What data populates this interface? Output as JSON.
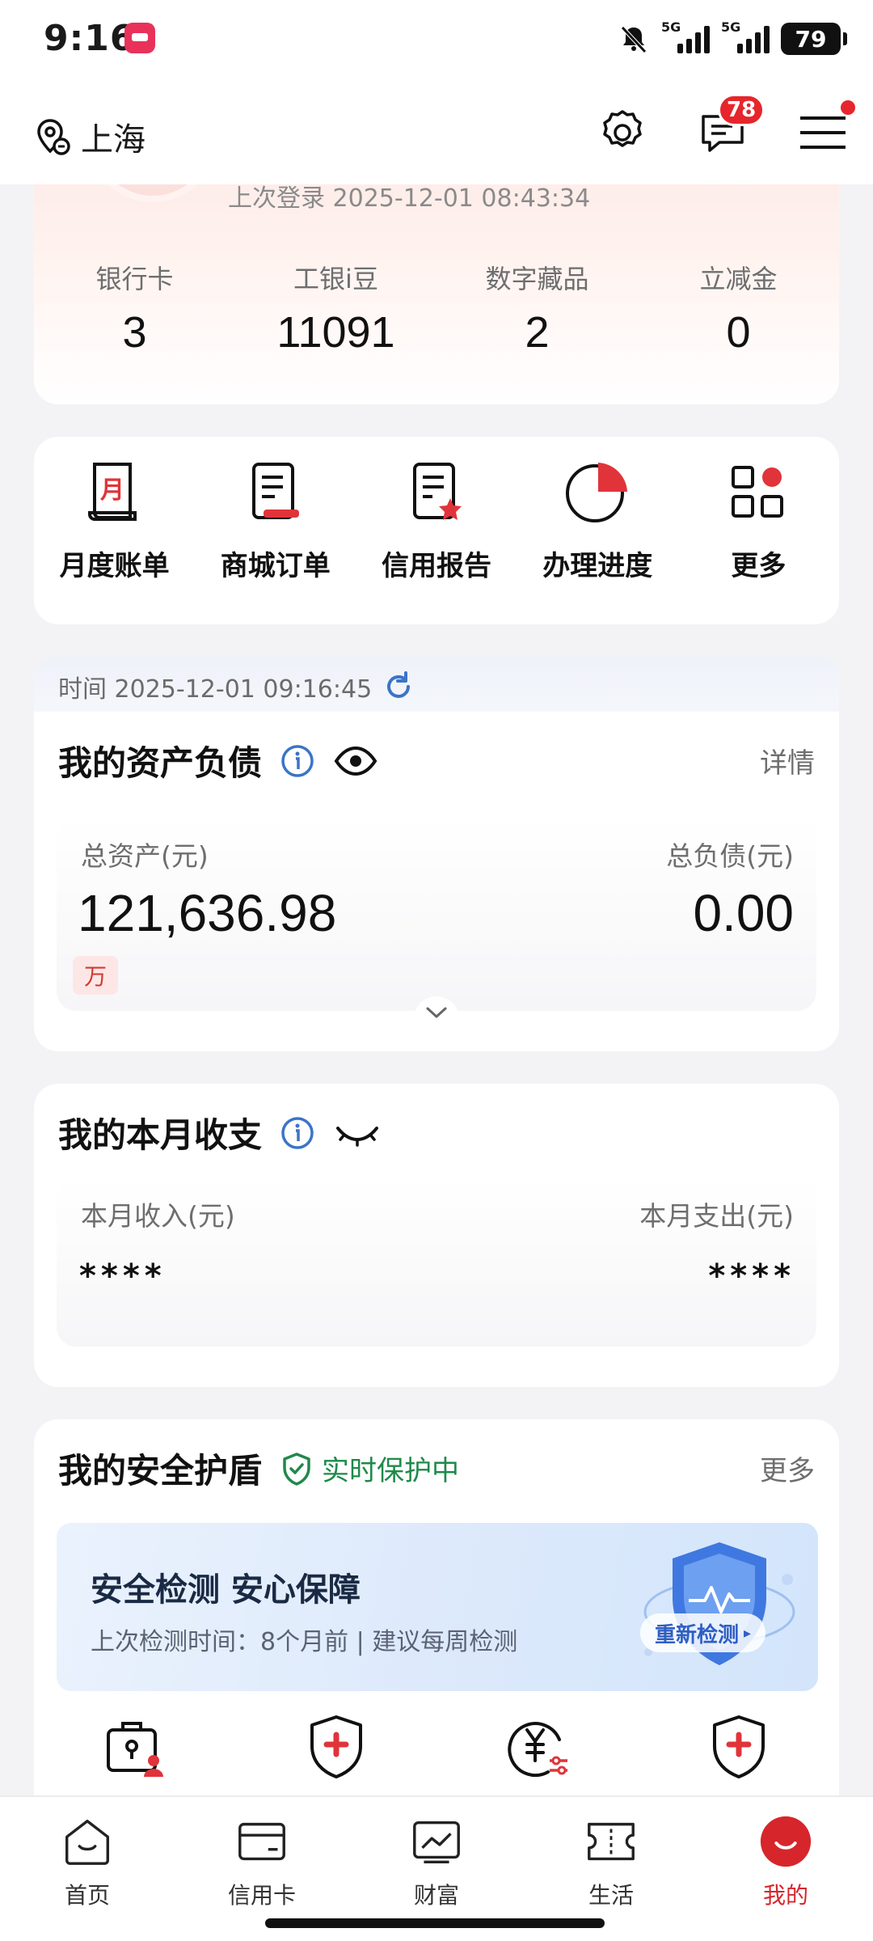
{
  "status_bar": {
    "time": "9:16",
    "battery": "79",
    "network_1": "5G",
    "network_2": "5G"
  },
  "header": {
    "location": "上海",
    "message_badge": "78"
  },
  "profile": {
    "last_login": "上次登录 2025-12-01 08:43:34",
    "stats": [
      {
        "label": "银行卡",
        "value": "3"
      },
      {
        "label": "工银i豆",
        "value": "11091"
      },
      {
        "label": "数字藏品",
        "value": "2"
      },
      {
        "label": "立减金",
        "value": "0"
      }
    ]
  },
  "quick_actions": [
    {
      "label": "月度账单",
      "icon": "monthly-bill-icon"
    },
    {
      "label": "商城订单",
      "icon": "mall-order-icon"
    },
    {
      "label": "信用报告",
      "icon": "credit-report-icon"
    },
    {
      "label": "办理进度",
      "icon": "progress-pie-icon"
    },
    {
      "label": "更多",
      "icon": "more-grid-icon"
    }
  ],
  "timestamp": "时间 2025-12-01 09:16:45",
  "assets": {
    "title": "我的资产负债",
    "detail_link": "详情",
    "total_assets_label": "总资产(元)",
    "total_assets_value": "121,636.98",
    "total_liabilities_label": "总负债(元)",
    "total_liabilities_value": "0.00",
    "unit_tag": "万"
  },
  "income": {
    "title": "我的本月收支",
    "income_label": "本月收入(元)",
    "income_value": "****",
    "expense_label": "本月支出(元)",
    "expense_value": "****"
  },
  "security": {
    "title": "我的安全护盾",
    "status": "实时保护中",
    "more_link": "更多",
    "banner_title": "安全检测 安心保障",
    "banner_subtitle": "上次检测时间：8个月前 | 建议每周检测",
    "recheck_button": "重新检测"
  },
  "bottom_nav": [
    {
      "label": "首页",
      "icon": "home-icon",
      "active": false
    },
    {
      "label": "信用卡",
      "icon": "credit-card-icon",
      "active": false
    },
    {
      "label": "财富",
      "icon": "wealth-chart-icon",
      "active": false
    },
    {
      "label": "生活",
      "icon": "life-ticket-icon",
      "active": false
    },
    {
      "label": "我的",
      "icon": "profile-smile-icon",
      "active": true
    }
  ],
  "colors": {
    "brand_red": "#d6262c",
    "protect_green": "#1e8a4a",
    "info_blue": "#3b74c8"
  }
}
